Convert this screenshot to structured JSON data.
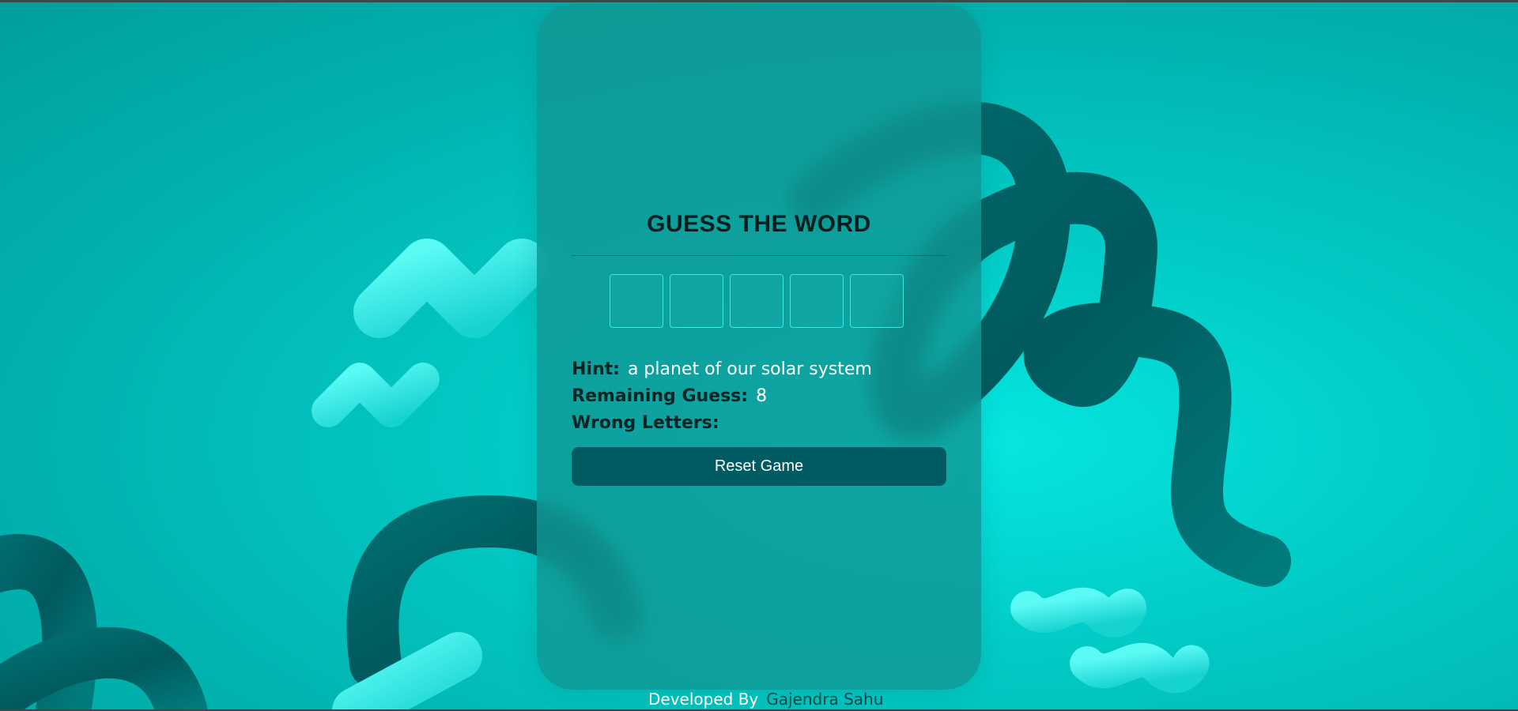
{
  "game": {
    "title": "GUESS THE WORD",
    "letter_boxes": [
      "",
      "",
      "",
      "",
      ""
    ],
    "hint_label": "Hint:",
    "hint_value": "a planet of our solar system",
    "remaining_label": "Remaining Guess:",
    "remaining_value": "8",
    "wrong_label": "Wrong Letters:",
    "wrong_value": "",
    "reset_label": "Reset Game"
  },
  "footer": {
    "label": "Developed By",
    "author": "Gajendra Sahu"
  },
  "colors": {
    "background": "#02c9c4",
    "card": "#109694",
    "button": "#015b63",
    "letter_border": "#3ae9e3"
  }
}
